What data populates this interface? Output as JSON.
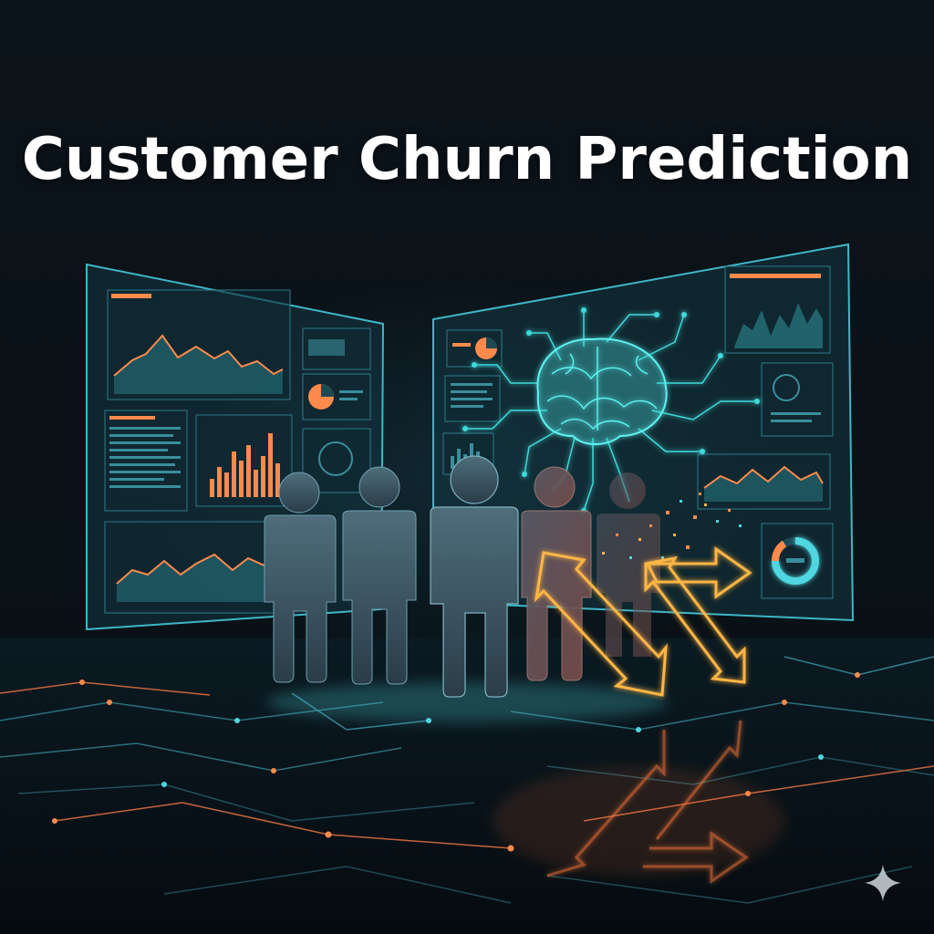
{
  "title": "Customer Churn Prediction",
  "colors": {
    "background": "#0a1118",
    "panel_glow": "#4fd6e0",
    "accent_orange": "#ff8a4c",
    "churn_arrow": "#ffb545",
    "brain": "#5ef2f0",
    "person": "#3e5866"
  },
  "icons": [
    "brain-icon",
    "person-icon",
    "churn-arrow-icon",
    "sparkle-icon"
  ]
}
